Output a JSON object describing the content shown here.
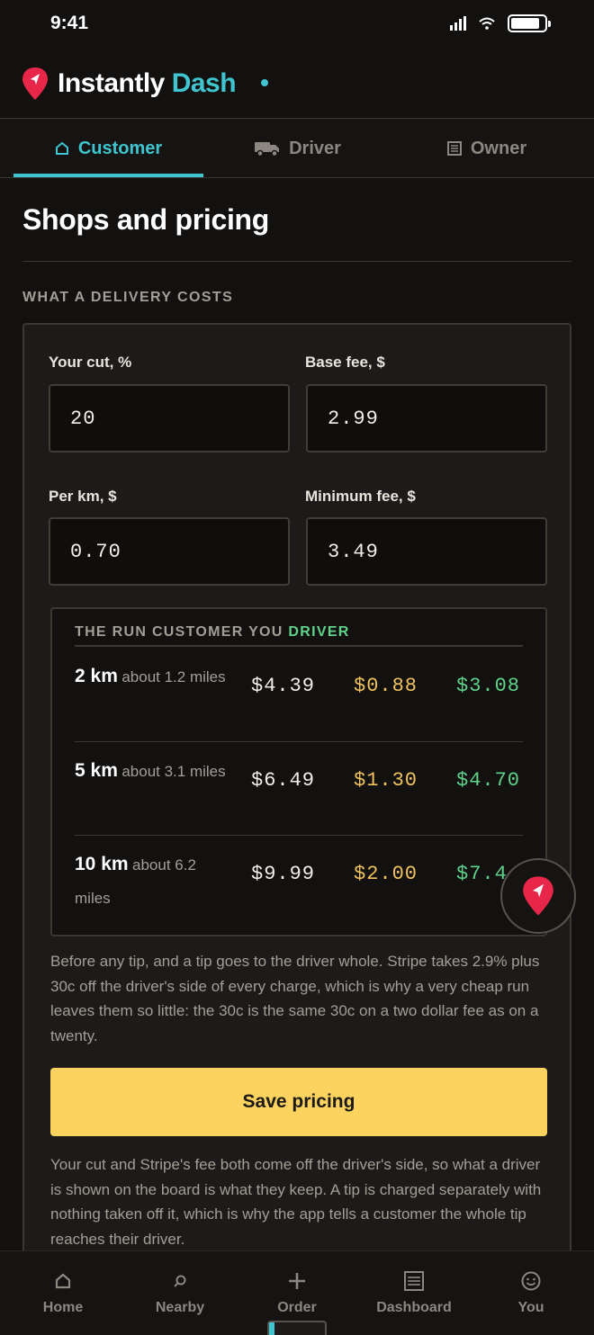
{
  "status_bar": {
    "time": "9:41"
  },
  "app": {
    "brand_part1": "Instantly",
    "brand_part2": "Dash",
    "accent": "#3ec5cf"
  },
  "role_tabs": [
    {
      "label": "Customer",
      "icon": "home-icon",
      "active": true
    },
    {
      "label": "Driver",
      "icon": "truck-icon",
      "active": false
    },
    {
      "label": "Owner",
      "icon": "list-icon",
      "active": false
    }
  ],
  "page": {
    "title": "Shops and pricing",
    "section_label": "WHAT A DELIVERY COSTS"
  },
  "pricing": {
    "cut_label": "Your cut, %",
    "cut_value": "20",
    "base_label": "Base fee, $",
    "base_value": "2.99",
    "per_km_label": "Per km, $",
    "per_km_value": "0.70",
    "min_label": "Minimum fee, $",
    "min_value": "3.49"
  },
  "examples": {
    "header_prefix": "THE RUN CUSTOMER YOU ",
    "header_driver": "DRIVER",
    "rows": [
      {
        "km": "2 km",
        "miles": "about 1.2 miles",
        "run": "$4.39",
        "cut": "$0.88",
        "driver": "$3.08"
      },
      {
        "km": "5 km",
        "miles": "about 3.1 miles",
        "run": "$6.49",
        "cut": "$1.30",
        "driver": "$4.70"
      },
      {
        "km": "10 km",
        "miles": "about 6.2 miles",
        "run": "$9.99",
        "cut": "$2.00",
        "driver": "$7.4"
      }
    ]
  },
  "note_tip": "Before any tip, and a tip goes to the driver whole. Stripe takes 2.9% plus 30c off the driver's side of every charge, which is why a very cheap run leaves them so little: the 30c is the same 30c on a two dollar fee as on a twenty.",
  "save_label": "Save pricing",
  "note_cut": "Your cut and Stripe's fee both come off the driver's side, so what a driver is shown on the board is what they keep. A tip is charged separately with nothing taken off it, which is why the app tells a customer the whole tip reaches their driver.",
  "bottom_nav": [
    {
      "label": "Home",
      "icon": "home-icon"
    },
    {
      "label": "Nearby",
      "icon": "search-icon"
    },
    {
      "label": "Order",
      "icon": "plus-icon"
    },
    {
      "label": "Dashboard",
      "icon": "dashboard-icon"
    },
    {
      "label": "You",
      "icon": "smiley-icon"
    }
  ],
  "colors": {
    "cut": "#f0c25c",
    "driver": "#5fd38a",
    "button": "#fdd35f",
    "brand_pin": "#e8264a"
  }
}
